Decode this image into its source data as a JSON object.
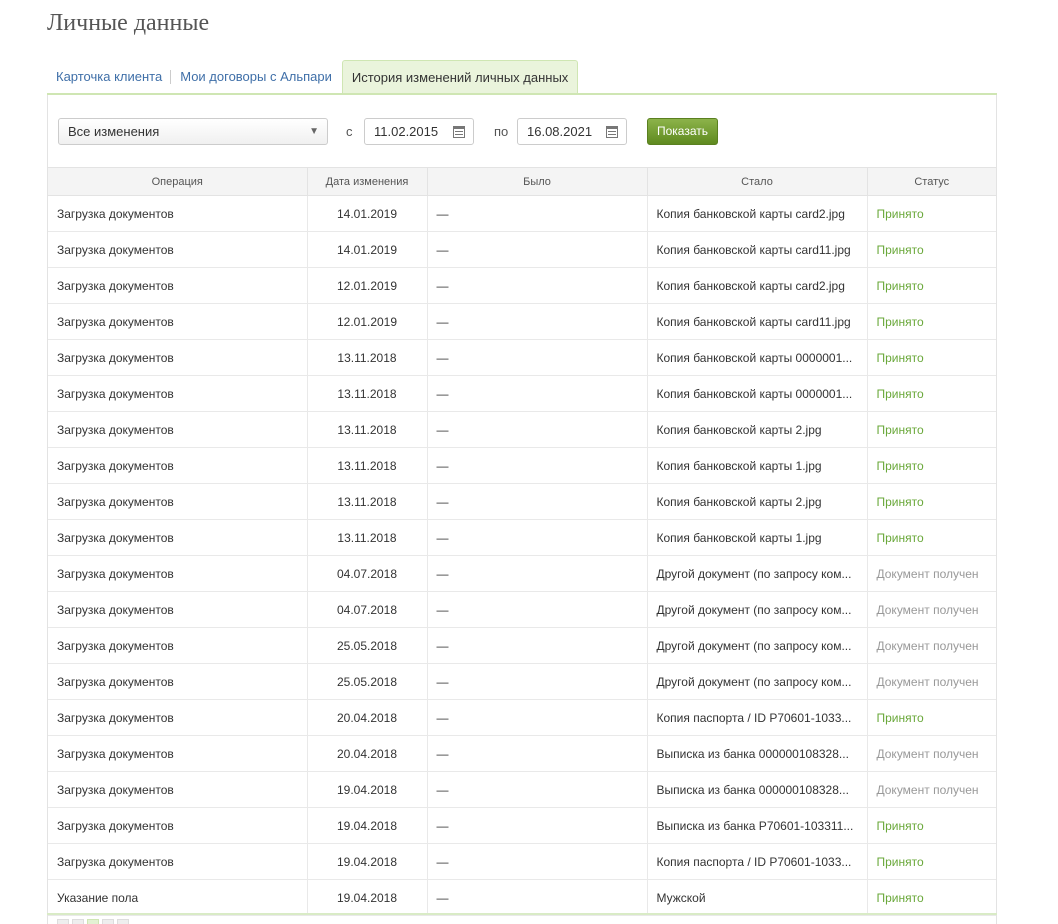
{
  "page": {
    "title": "Личные данные"
  },
  "tabs": [
    {
      "label": "Карточка клиента"
    },
    {
      "label": "Мои договоры с Альпари"
    },
    {
      "label": "История изменений личных данных"
    }
  ],
  "filters": {
    "type_selected": "Все изменения",
    "from_label": "с",
    "from_date": "11.02.2015",
    "to_label": "по",
    "to_date": "16.08.2021",
    "submit_label": "Показать"
  },
  "table": {
    "headers": [
      "Операция",
      "Дата изменения",
      "Было",
      "Стало",
      "Статус"
    ],
    "rows": [
      [
        "Загрузка документов",
        "14.01.2019",
        "—",
        "Копия банковской карты card2.jpg",
        "Принято"
      ],
      [
        "Загрузка документов",
        "14.01.2019",
        "—",
        "Копия банковской карты card11.jpg",
        "Принято"
      ],
      [
        "Загрузка документов",
        "12.01.2019",
        "—",
        "Копия банковской карты card2.jpg",
        "Принято"
      ],
      [
        "Загрузка документов",
        "12.01.2019",
        "—",
        "Копия банковской карты card11.jpg",
        "Принято"
      ],
      [
        "Загрузка документов",
        "13.11.2018",
        "—",
        "Копия банковской карты 0000001...",
        "Принято"
      ],
      [
        "Загрузка документов",
        "13.11.2018",
        "—",
        "Копия банковской карты 0000001...",
        "Принято"
      ],
      [
        "Загрузка документов",
        "13.11.2018",
        "—",
        "Копия банковской карты 2.jpg",
        "Принято"
      ],
      [
        "Загрузка документов",
        "13.11.2018",
        "—",
        "Копия банковской карты 1.jpg",
        "Принято"
      ],
      [
        "Загрузка документов",
        "13.11.2018",
        "—",
        "Копия банковской карты 2.jpg",
        "Принято"
      ],
      [
        "Загрузка документов",
        "13.11.2018",
        "—",
        "Копия банковской карты 1.jpg",
        "Принято"
      ],
      [
        "Загрузка документов",
        "04.07.2018",
        "—",
        "Другой документ (по запросу ком...",
        "Документ получен"
      ],
      [
        "Загрузка документов",
        "04.07.2018",
        "—",
        "Другой документ (по запросу ком...",
        "Документ получен"
      ],
      [
        "Загрузка документов",
        "25.05.2018",
        "—",
        "Другой документ (по запросу ком...",
        "Документ получен"
      ],
      [
        "Загрузка документов",
        "25.05.2018",
        "—",
        "Другой документ (по запросу ком...",
        "Документ получен"
      ],
      [
        "Загрузка документов",
        "20.04.2018",
        "—",
        "Копия паспорта / ID P70601-1033...",
        "Принято"
      ],
      [
        "Загрузка документов",
        "20.04.2018",
        "—",
        "Выписка из банка 000000108328...",
        "Документ получен"
      ],
      [
        "Загрузка документов",
        "19.04.2018",
        "—",
        "Выписка из банка 000000108328...",
        "Документ получен"
      ],
      [
        "Загрузка документов",
        "19.04.2018",
        "—",
        "Выписка из банка P70601-103311...",
        "Принято"
      ],
      [
        "Загрузка документов",
        "19.04.2018",
        "—",
        "Копия паспорта / ID P70601-1033...",
        "Принято"
      ],
      [
        "Указание пола",
        "19.04.2018",
        "—",
        "Мужской",
        "Принято"
      ]
    ]
  },
  "colors": {
    "accepted": "#6aa83a",
    "received": "#999999",
    "button": "#6e9a2c"
  },
  "icons": {
    "select_arrow": "chevron-down-icon",
    "date_picker": "calendar-icon"
  }
}
